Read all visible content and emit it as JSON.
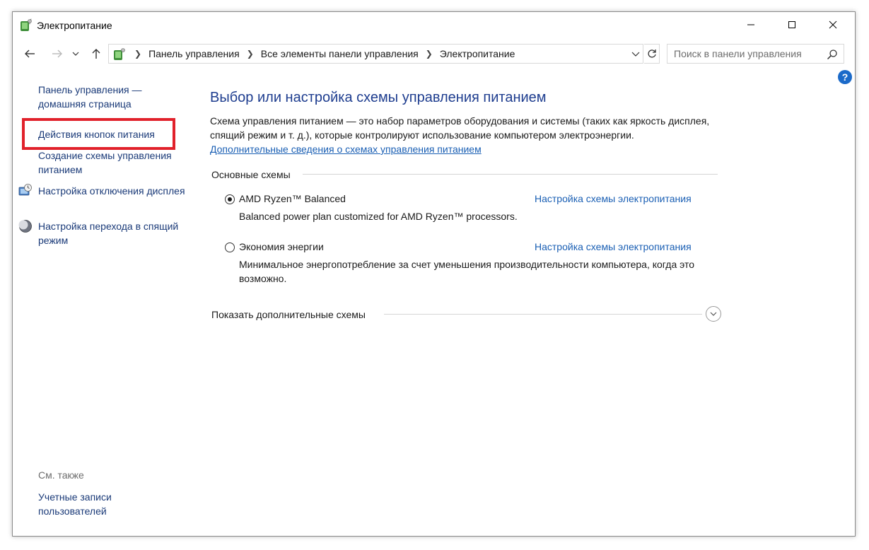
{
  "window": {
    "title": "Электропитание"
  },
  "address": {
    "breadcrumbs": [
      "Панель управления",
      "Все элементы панели управления",
      "Электропитание"
    ]
  },
  "search": {
    "placeholder": "Поиск в панели управления"
  },
  "help": {
    "label": "?"
  },
  "sidebar": {
    "home_link": "Панель управления — домашняя страница",
    "items": [
      {
        "label": "Действия кнопок питания",
        "icon": "none",
        "highlighted": true
      },
      {
        "label": "Создание схемы управления питанием",
        "icon": "none"
      },
      {
        "label": "Настройка отключения дисплея",
        "icon": "display-clock-icon"
      },
      {
        "label": "Настройка перехода в спящий режим",
        "icon": "moon-icon"
      }
    ],
    "see_also_label": "См. также",
    "see_also_items": [
      {
        "label": "Учетные записи пользователей"
      }
    ]
  },
  "main": {
    "title": "Выбор или настройка схемы управления питанием",
    "description": "Схема управления питанием — это набор параметров оборудования и системы (таких как яркость дисплея, спящий режим и т. д.), которые контролируют использование компьютером электроэнергии.",
    "info_link": "Дополнительные сведения о схемах управления питанием",
    "section_label": "Основные схемы",
    "plans": [
      {
        "name": "AMD Ryzen™ Balanced",
        "description": "Balanced power plan customized for AMD Ryzen™ processors.",
        "settings_link": "Настройка схемы электропитания",
        "selected": true
      },
      {
        "name": "Экономия энергии",
        "description": "Минимальное энергопотребление за счет уменьшения производительности компьютера, когда это возможно.",
        "settings_link": "Настройка схемы электропитания",
        "selected": false
      }
    ],
    "more_plans_label": "Показать дополнительные схемы"
  },
  "colors": {
    "highlight_box": "#e1212b",
    "title_blue": "#1e3d8f",
    "link_blue": "#1a5fb4",
    "help_blue": "#1b6ac9"
  }
}
